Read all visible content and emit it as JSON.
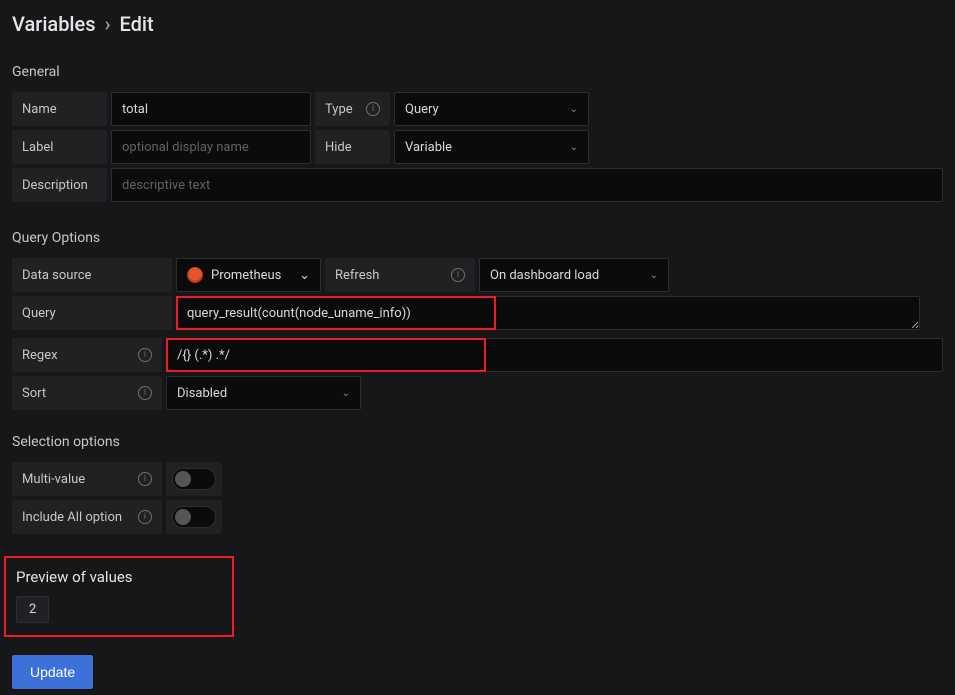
{
  "title": {
    "main": "Variables",
    "sub": "Edit"
  },
  "sections": {
    "general": "General",
    "queryOptions": "Query Options",
    "selectionOptions": "Selection options",
    "preview": "Preview of values"
  },
  "general": {
    "nameLabel": "Name",
    "nameValue": "total",
    "typeLabel": "Type",
    "typeValue": "Query",
    "labelLabel": "Label",
    "labelPlaceholder": "optional display name",
    "hideLabel": "Hide",
    "hideValue": "Variable",
    "descLabel": "Description",
    "descPlaceholder": "descriptive text"
  },
  "queryOptions": {
    "dataSourceLabel": "Data source",
    "dataSourceValue": "Prometheus",
    "refreshLabel": "Refresh",
    "refreshValue": "On dashboard load",
    "queryLabel": "Query",
    "queryValue": "query_result(count(node_uname_info))",
    "regexLabel": "Regex",
    "regexValue": "/{} (.*) .*/",
    "sortLabel": "Sort",
    "sortValue": "Disabled"
  },
  "selection": {
    "multiLabel": "Multi-value",
    "includeAllLabel": "Include All option",
    "multiOn": false,
    "includeAllOn": false
  },
  "preview": {
    "values": [
      "2"
    ]
  },
  "buttons": {
    "update": "Update"
  },
  "icons": {
    "info": "i",
    "chevron": "⌄"
  }
}
